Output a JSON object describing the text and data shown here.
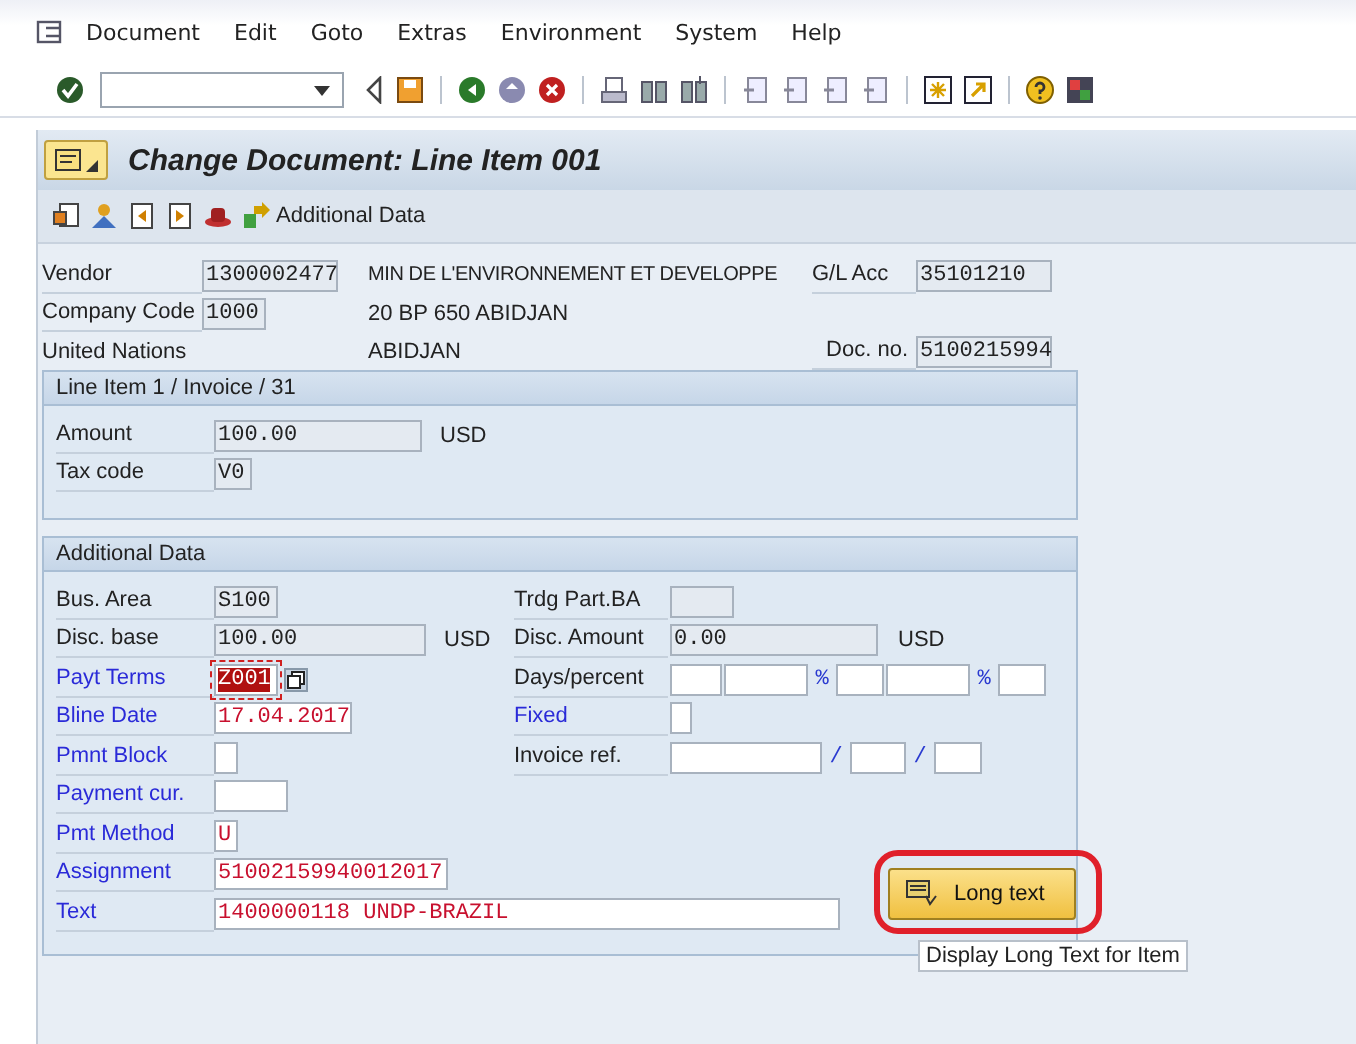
{
  "menu": [
    {
      "label": "Document"
    },
    {
      "label": "Edit"
    },
    {
      "label": "Goto"
    },
    {
      "label": "Extras"
    },
    {
      "label": "Environment"
    },
    {
      "label": "System"
    },
    {
      "label": "Help"
    }
  ],
  "title": "Change Document: Line Item 001",
  "app_toolbar": {
    "additional_data": "Additional Data"
  },
  "header": {
    "vendor": {
      "label": "Vendor",
      "value": "1300002477"
    },
    "vendor_name": "MIN DE L'ENVIRONNEMENT ET DEVELOPPE",
    "gl_acc": {
      "label": "G/L Acc",
      "value": "35101210"
    },
    "company_code": {
      "label": "Company Code",
      "value": "1000"
    },
    "address": "20 BP 650 ABIDJAN",
    "company_name": "United Nations",
    "city": "ABIDJAN",
    "doc_no": {
      "label": "Doc. no.",
      "value": "5100215994"
    }
  },
  "line_item": {
    "title": "Line Item 1 / Invoice / 31",
    "amount": {
      "label": "Amount",
      "value": "100.00",
      "editable": false,
      "changed": false,
      "currency": "USD"
    },
    "tax_code": {
      "label": "Tax code",
      "value": "V0",
      "editable": false,
      "changed": false
    }
  },
  "additional_data": {
    "title": "Additional Data",
    "bus_area": {
      "label": "Bus. Area",
      "link": false,
      "value": "S100",
      "editable": false,
      "changed": false
    },
    "trdg_part_ba": {
      "label": "Trdg Part.BA",
      "link": false,
      "editable": false
    },
    "disc_base": {
      "label": "Disc. base",
      "link": false,
      "value": "100.00",
      "editable": false,
      "changed": false,
      "currency": "USD"
    },
    "disc_amount": {
      "label": "Disc. Amount",
      "link": false,
      "value": "0.00",
      "editable": false,
      "changed": false,
      "currency": "USD"
    },
    "payt_terms": {
      "label": "Payt Terms",
      "link": true,
      "value": "Z001",
      "editable": true,
      "focused": true
    },
    "days_percent": {
      "label": "Days/percent",
      "link": false,
      "signs": [
        "%",
        "%"
      ]
    },
    "bline_date": {
      "label": "Bline Date",
      "link": true,
      "value": "17.04.2017",
      "editable": true,
      "changed": true
    },
    "fixed": {
      "label": "Fixed",
      "link": true,
      "editable": true
    },
    "pmnt_block": {
      "label": "Pmnt Block",
      "link": true,
      "editable": true
    },
    "invoice_ref": {
      "label": "Invoice ref.",
      "link": false,
      "separators": [
        "/",
        "/"
      ]
    },
    "payment_cur": {
      "label": "Payment cur.",
      "link": true,
      "editable": true
    },
    "pmt_method": {
      "label": "Pmt Method",
      "link": true,
      "value": "U",
      "editable": true,
      "changed": true
    },
    "assignment": {
      "label": "Assignment",
      "link": true,
      "value": "51002159940012017",
      "editable": true,
      "changed": true
    },
    "text": {
      "label": "Text",
      "link": true,
      "value": "1400000118 UNDP-BRAZIL",
      "editable": true,
      "changed": true
    },
    "long_text_button": {
      "label": "Long text",
      "highlighted": true
    },
    "tooltip": "Display Long Text for Item"
  }
}
